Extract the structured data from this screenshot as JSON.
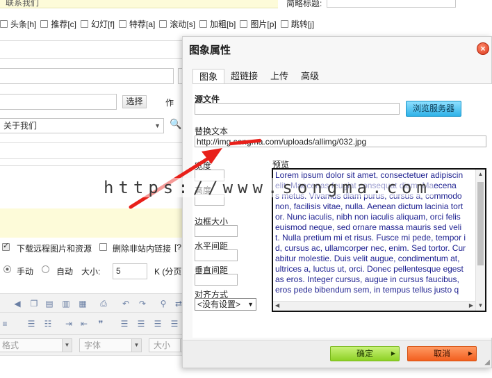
{
  "background": {
    "top_text": "联系我们",
    "subtitle_label": "简略标题:",
    "flags": [
      {
        "label": "头条[h]"
      },
      {
        "label": "推荐[c]"
      },
      {
        "label": "幻灯[f]"
      },
      {
        "label": "特荐[a]"
      },
      {
        "label": "滚动[s]"
      },
      {
        "label": "加粗[b]"
      },
      {
        "label": "图片[p]"
      },
      {
        "label": "跳转[j]"
      }
    ],
    "select_button": "选择",
    "author_label": "作",
    "category_value": "关于我们",
    "download_remote_label": "下载远程图片和资源",
    "remove_links_label": "删除非站内链接",
    "remove_links_suffix": "[?",
    "radio_manual": "手动",
    "radio_auto": "自动",
    "size_label": "大小:",
    "size_value": "5",
    "size_unit": "K (分页",
    "format_placeholder": "格式",
    "font_placeholder": "字体",
    "size_placeholder": "大小"
  },
  "dialog": {
    "title": "图象属性",
    "close_icon": "close-icon",
    "tabs": [
      {
        "label": "图象"
      },
      {
        "label": "超链接"
      },
      {
        "label": "上传"
      },
      {
        "label": "高级"
      }
    ],
    "source_label": "源文件",
    "browse_button": "浏览服务器",
    "alt_label": "替换文本",
    "alt_value": "http://img.songma.com/uploads/allimg/032.jpg",
    "width_label": "宽度",
    "height_label": "高度",
    "border_label": "边框大小",
    "hspace_label": "水平间距",
    "vspace_label": "垂直间距",
    "align_label": "对齐方式",
    "align_value": "<没有设置>",
    "preview_label": "预览",
    "preview_lines": [
      "Lorem ipsum dolor sit amet, consectetuer adipiscin",
      "elit. Maecenas feugiat consequat diam. Maecena",
      "s metus. Vivamus diam purus, cursus a, commodo",
      "non, facilisis vitae, nulla. Aenean dictum lacinia tort",
      "or. Nunc iaculis, nibh non iaculis aliquam, orci felis",
      "euismod neque, sed ornare massa mauris sed veli",
      "t. Nulla pretium mi et risus. Fusce mi pede, tempor i",
      "d, cursus ac, ullamcorper nec, enim. Sed tortor. Cur",
      "abitur molestie. Duis velit augue, condimentum at,",
      "ultrices a, luctus ut, orci. Donec pellentesque egest",
      "as eros. Integer cursus, augue in cursus faucibus,",
      "eros pede bibendum sem, in tempus tellus justo q"
    ],
    "ok_button": "确定",
    "cancel_button": "取消"
  },
  "watermark": "https://www.songma.com",
  "colors": {
    "annotation_red": "#e8201a",
    "ok_green": "#8dd125",
    "cancel_orange": "#f25f1f",
    "browse_blue": "#2fb2e8"
  }
}
